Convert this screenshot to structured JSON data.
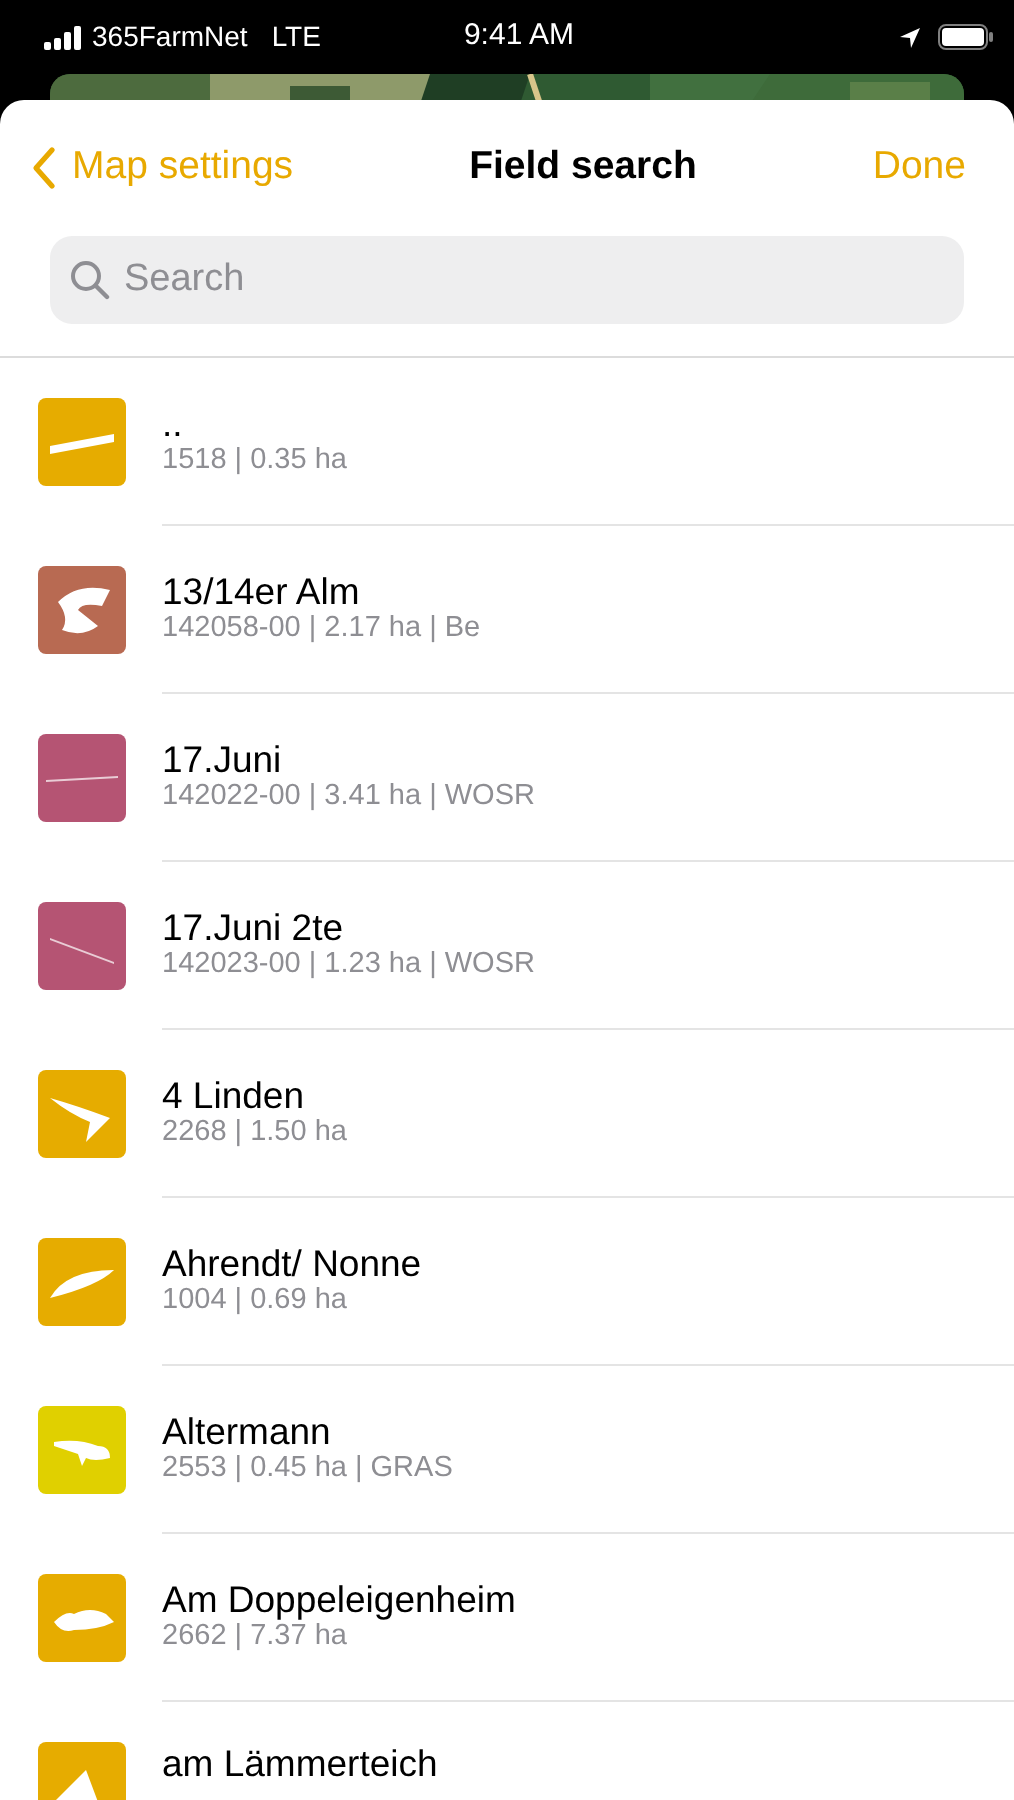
{
  "status_bar": {
    "carrier": "365FarmNet",
    "network": "LTE",
    "time": "9:41 AM"
  },
  "nav": {
    "back": "Map settings",
    "title": "Field search",
    "done": "Done"
  },
  "search": {
    "placeholder": "Search"
  },
  "fields": [
    {
      "name": "..",
      "details": "1518 | 0.35 ha",
      "color": "#e6ac00"
    },
    {
      "name": "13/14er Alm",
      "details": "142058-00 | 2.17 ha | Be",
      "color": "#b86a52"
    },
    {
      "name": "17.Juni",
      "details": "142022-00 | 3.41 ha | WOSR",
      "color": "#b55473"
    },
    {
      "name": "17.Juni 2te",
      "details": "142023-00 | 1.23 ha | WOSR",
      "color": "#b55473"
    },
    {
      "name": "4 Linden",
      "details": "2268 | 1.50 ha",
      "color": "#e6ac00"
    },
    {
      "name": "Ahrendt/ Nonne",
      "details": "1004 | 0.69 ha",
      "color": "#e6ac00"
    },
    {
      "name": "Altermann",
      "details": "2553 | 0.45 ha | GRAS",
      "color": "#e0d000"
    },
    {
      "name": "Am Doppeleigenheim",
      "details": "2662 | 7.37 ha",
      "color": "#e6ac00"
    },
    {
      "name": "am Lämmerteich",
      "color": "#e6ac00"
    }
  ]
}
